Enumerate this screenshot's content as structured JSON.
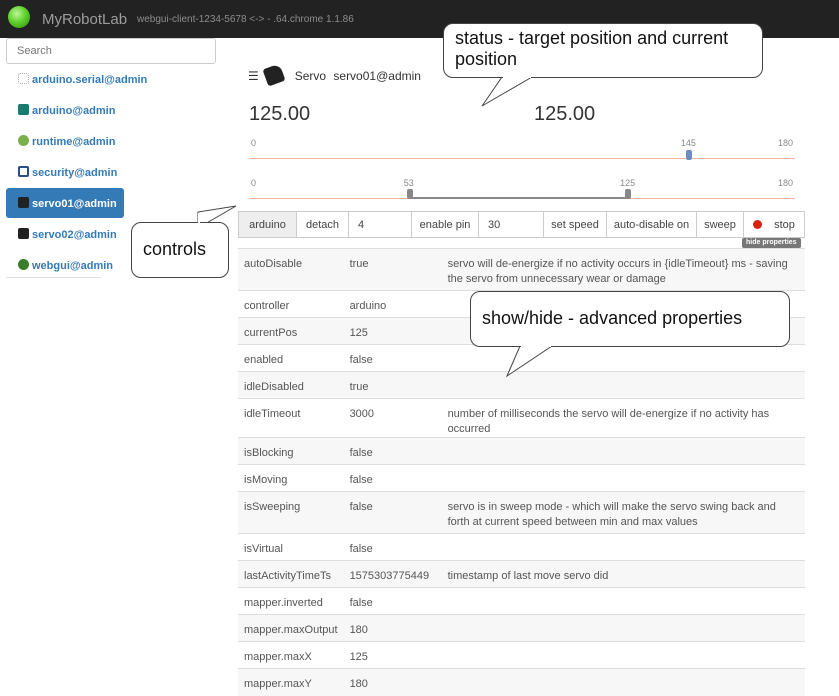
{
  "topbar": {
    "brand": "MyRobotLab",
    "client": "webgui-client-1234-5678 <-> - .64.chrome 1.1.86"
  },
  "search": {
    "placeholder": "Search"
  },
  "sidebar": {
    "items": [
      {
        "label": "arduino.serial@admin",
        "icon": "serial-icon"
      },
      {
        "label": "arduino@admin",
        "icon": "arduino-icon"
      },
      {
        "label": "runtime@admin",
        "icon": "runtime-icon"
      },
      {
        "label": "security@admin",
        "icon": "security-icon"
      },
      {
        "label": "servo01@admin",
        "icon": "servo-icon",
        "active": true
      },
      {
        "label": "servo02@admin",
        "icon": "servo-icon"
      },
      {
        "label": "webgui@admin",
        "icon": "webgui-icon"
      }
    ]
  },
  "panel": {
    "type_label": "Servo",
    "name": "servo01@admin",
    "target_pos": "125.00",
    "current_pos": "125.00",
    "pos_slider": {
      "min": "0",
      "max": "180",
      "value": "145",
      "value_num": 145,
      "max_num": 180
    },
    "range_slider": {
      "min": "0",
      "max": "180",
      "low": "53",
      "high": "125",
      "low_num": 53,
      "high_num": 125,
      "max_num": 180
    }
  },
  "controls": {
    "controller": "arduino",
    "detach": "detach",
    "pin_value": "4",
    "enable_pin": "enable pin",
    "speed_value": "30",
    "set_speed": "set speed",
    "auto_disable": "auto-disable on",
    "sweep": "sweep",
    "stop": "stop",
    "hide_properties": "hide properties"
  },
  "properties": [
    {
      "name": "autoDisable",
      "value": "true",
      "desc": "servo will de-energize if no activity occurs in {idleTimeout} ms - saving the servo from unnecessary wear or damage"
    },
    {
      "name": "controller",
      "value": "arduino",
      "desc": ""
    },
    {
      "name": "currentPos",
      "value": "125",
      "desc": ""
    },
    {
      "name": "enabled",
      "value": "false",
      "desc": ""
    },
    {
      "name": "idleDisabled",
      "value": "true",
      "desc": ""
    },
    {
      "name": "idleTimeout",
      "value": "3000",
      "desc": "number of milliseconds the servo will de-energize if no activity has occurred"
    },
    {
      "name": "isBlocking",
      "value": "false",
      "desc": ""
    },
    {
      "name": "isMoving",
      "value": "false",
      "desc": ""
    },
    {
      "name": "isSweeping",
      "value": "false",
      "desc": "servo is in sweep mode - which will make the servo swing back and forth at current speed between min and max values"
    },
    {
      "name": "isVirtual",
      "value": "false",
      "desc": ""
    },
    {
      "name": "lastActivityTimeTs",
      "value": "1575303775449",
      "desc": "timestamp of last move servo did"
    },
    {
      "name": "mapper.inverted",
      "value": "false",
      "desc": ""
    },
    {
      "name": "mapper.maxOutput",
      "value": "180",
      "desc": ""
    },
    {
      "name": "mapper.maxX",
      "value": "125",
      "desc": ""
    },
    {
      "name": "mapper.maxY",
      "value": "180",
      "desc": ""
    }
  ],
  "callouts": {
    "status": "status - target position and current position",
    "controls": "controls",
    "showhide": "show/hide - advanced properties"
  },
  "colors": {
    "accent": "#337ab7",
    "topbar": "#222222",
    "stop": "#d9230f",
    "slider_track": "#f5b59a",
    "slider_handle": "#6d8fbf"
  }
}
